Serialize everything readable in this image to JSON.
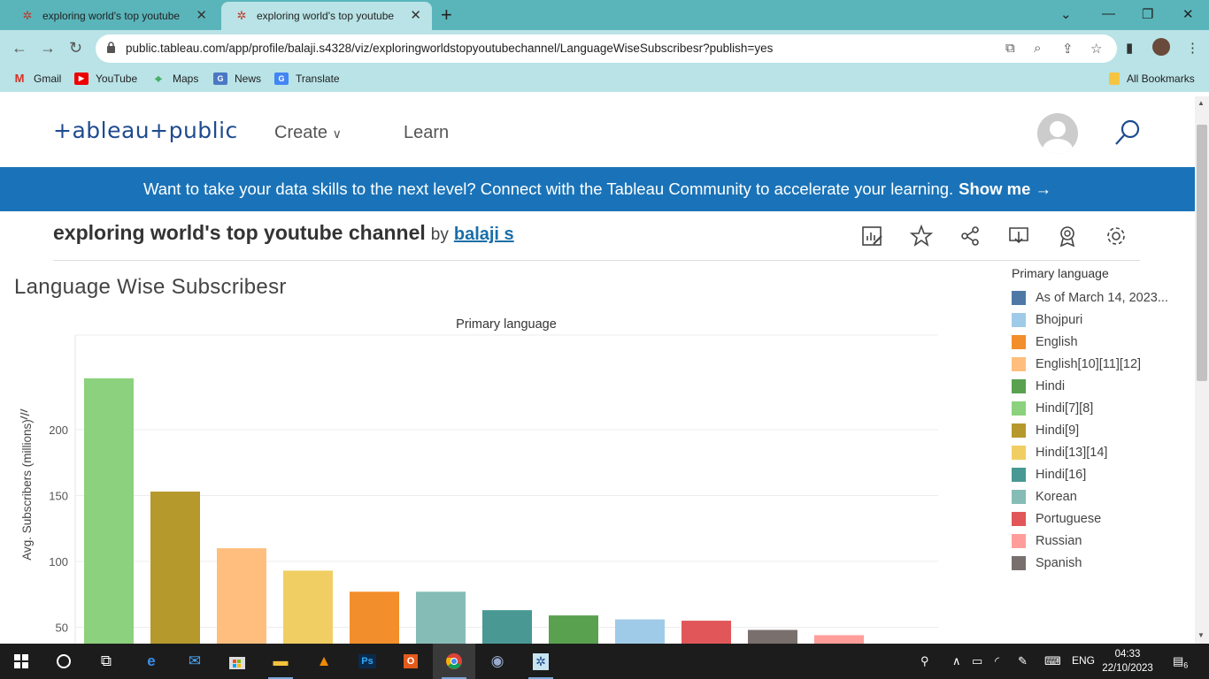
{
  "browser": {
    "tabs": [
      {
        "title": "exploring world's top youtube ch",
        "active": false
      },
      {
        "title": "exploring world's top youtube ch",
        "active": true
      }
    ],
    "url": "public.tableau.com/app/profile/balaji.s4328/viz/exploringworldstopyoutubechannel/LanguageWiseSubscribesr?publish=yes",
    "bookmarks": [
      "Gmail",
      "YouTube",
      "Maps",
      "News",
      "Translate"
    ],
    "all_bookmarks": "All Bookmarks"
  },
  "site": {
    "logo": "+ableau+public",
    "nav": {
      "create": "Create",
      "learn": "Learn"
    },
    "banner_text": "Want to take your data skills to the next level? Connect with the Tableau Community to accelerate your learning.",
    "banner_cta": "Show me →"
  },
  "viz": {
    "title": "exploring world's top youtube channel",
    "by": "by",
    "author": "balaji s",
    "sheet_title": "Language Wise Subscribesr"
  },
  "legend": {
    "title": "Primary language",
    "items": [
      {
        "label": "As of March 14, 2023...",
        "color": "#4e79a7"
      },
      {
        "label": "Bhojpuri",
        "color": "#a0cbe8"
      },
      {
        "label": "English",
        "color": "#f28e2b"
      },
      {
        "label": "English[10][11][12]",
        "color": "#ffbe7d"
      },
      {
        "label": "Hindi",
        "color": "#59a14f"
      },
      {
        "label": "Hindi[7][8]",
        "color": "#8cd17d"
      },
      {
        "label": "Hindi[9]",
        "color": "#b6992d"
      },
      {
        "label": "Hindi[13][14]",
        "color": "#f1ce63"
      },
      {
        "label": "Hindi[16]",
        "color": "#499894"
      },
      {
        "label": "Korean",
        "color": "#86bcb6"
      },
      {
        "label": "Portuguese",
        "color": "#e15759"
      },
      {
        "label": "Russian",
        "color": "#ff9d9a"
      },
      {
        "label": "Spanish",
        "color": "#79706e"
      }
    ]
  },
  "chart_data": {
    "type": "bar",
    "title": "Primary language",
    "ylabel": "Avg. Subscribers (millions)",
    "ylim": [
      25,
      250
    ],
    "yticks": [
      50,
      100,
      150,
      200
    ],
    "grid": true,
    "categories": [
      "Hindi[7][8]",
      "Hindi[9]",
      "English[10][11][12]",
      "Hindi[13][14]",
      "English",
      "Korean",
      "Hindi[16]",
      "Hindi",
      "Bhojpuri",
      "Portuguese",
      "Spanish",
      "Russian"
    ],
    "values": [
      239,
      153,
      110,
      93,
      77,
      77,
      63,
      59,
      56,
      55,
      48,
      44
    ],
    "colors": [
      "#8cd17d",
      "#b6992d",
      "#ffbe7d",
      "#f1ce63",
      "#f28e2b",
      "#86bcb6",
      "#499894",
      "#59a14f",
      "#a0cbe8",
      "#e15759",
      "#79706e",
      "#ff9d9a"
    ]
  },
  "taskbar": {
    "lang": "ENG",
    "time": "04:33",
    "date": "22/10/2023",
    "notifications": "6"
  }
}
